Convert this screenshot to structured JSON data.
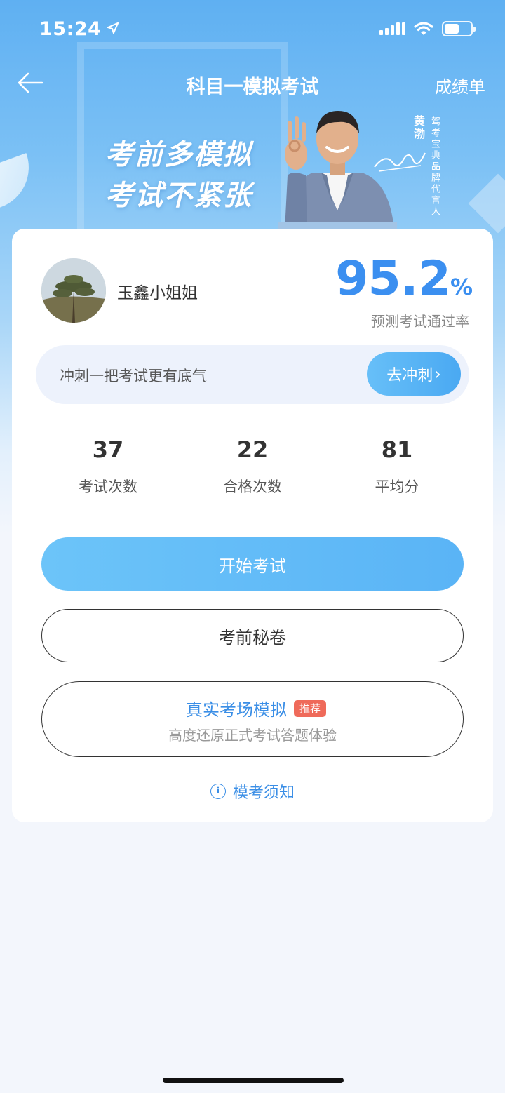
{
  "status_bar": {
    "time": "15:24"
  },
  "nav": {
    "title": "科目一模拟考试",
    "right_label": "成绩单"
  },
  "banner": {
    "slogan_line1": "考前多模拟",
    "slogan_line2": "考试不紧张",
    "endorser_name": "黄渤",
    "endorser_tagline": "驾考宝典品牌代言人"
  },
  "profile": {
    "username": "玉鑫小姐姐"
  },
  "pass_rate": {
    "value": "95.2",
    "unit": "%",
    "label": "预测考试通过率"
  },
  "sprint": {
    "text": "冲刺一把考试更有底气",
    "button_label": "去冲刺",
    "button_chevron": "›"
  },
  "stats": [
    {
      "value": "37",
      "label": "考试次数"
    },
    {
      "value": "22",
      "label": "合格次数"
    },
    {
      "value": "81",
      "label": "平均分"
    }
  ],
  "buttons": {
    "start_label": "开始考试",
    "secret_label": "考前秘卷",
    "real_title": "真实考场模拟",
    "real_badge": "推荐",
    "real_subtitle": "高度还原正式考试答题体验"
  },
  "notice": {
    "icon": "i",
    "label": "模考须知"
  },
  "colors": {
    "accent": "#3b8ff0",
    "badge": "#ef6a5a"
  }
}
